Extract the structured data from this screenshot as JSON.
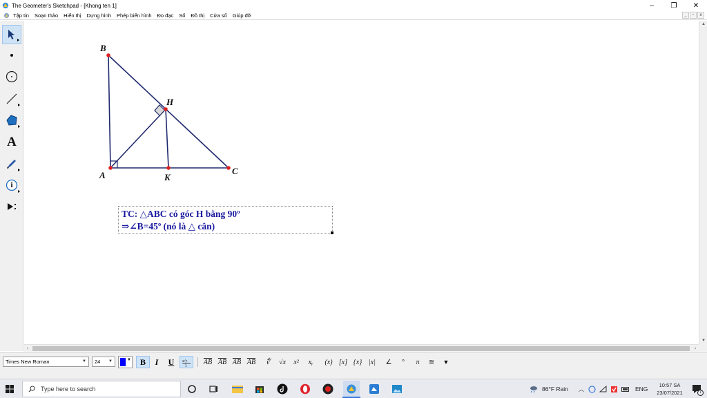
{
  "window": {
    "title": "The Geometer's Sketchpad - [Khong ten 1]",
    "controls": {
      "minimize": "–",
      "restore": "❐",
      "close": "✕"
    }
  },
  "menu": {
    "items": [
      "Tập tin",
      "Soạn thảo",
      "Hiển thị",
      "Dựng hình",
      "Phép biến hình",
      "Đo đạc",
      "Số",
      "Đồ thị",
      "Cửa sổ",
      "Giúp đỡ"
    ],
    "mdi": [
      "_",
      "▫",
      "x"
    ]
  },
  "toolbox": {
    "tools": [
      {
        "name": "arrow-select-tool",
        "glyph": "arrow"
      },
      {
        "name": "point-tool",
        "glyph": "point"
      },
      {
        "name": "compass-tool",
        "glyph": "circle"
      },
      {
        "name": "straightedge-tool",
        "glyph": "line"
      },
      {
        "name": "polygon-tool",
        "glyph": "polygon"
      },
      {
        "name": "text-tool",
        "glyph": "A"
      },
      {
        "name": "marker-tool",
        "glyph": "pen"
      },
      {
        "name": "information-tool",
        "glyph": "i"
      },
      {
        "name": "custom-tool",
        "glyph": "play"
      }
    ],
    "text_glyph": "A",
    "info_glyph": "i"
  },
  "figure": {
    "labels": {
      "B": "B",
      "H": "H",
      "A": "A",
      "K": "K",
      "C": "C"
    },
    "point_color": "#e02020",
    "line_color": "#1f2a6e"
  },
  "caption": {
    "line1": "TC: △ABC có góc H bằng 90º",
    "line2": "⇒∠B=45º (nó là △ cân)",
    "color": "#1a1aa0"
  },
  "formatbar": {
    "font": "Times New Roman",
    "size": "24",
    "color": "#0000ff",
    "bold": "B",
    "italic": "I",
    "underline": "U",
    "symbols": [
      "AB",
      "AB",
      "AB",
      "AB",
      "∜",
      "√x",
      "x²",
      "xᵧ",
      "(x)",
      "[x]",
      "{x}",
      "|x|",
      "∠",
      "°",
      "π",
      "≅",
      "▼"
    ]
  },
  "taskbar": {
    "search_placeholder": "Type here to search",
    "weather": "86°F  Rain",
    "language": "ENG",
    "time": "10:57 SA",
    "date": "23/07/2021",
    "notification_count": "7"
  }
}
